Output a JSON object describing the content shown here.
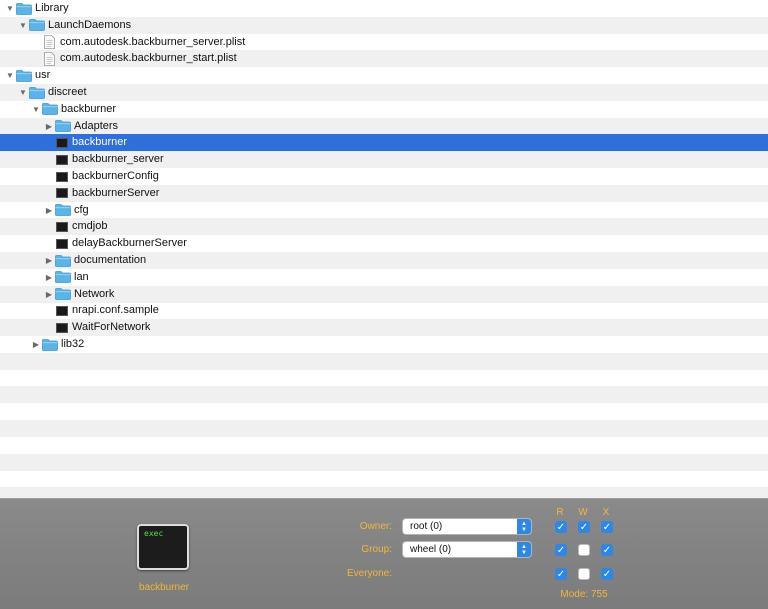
{
  "tree": [
    {
      "label": "Library",
      "kind": "folder",
      "expanded": true,
      "indent": 0,
      "selected": false
    },
    {
      "label": "LaunchDaemons",
      "kind": "folder",
      "expanded": true,
      "indent": 1,
      "selected": false
    },
    {
      "label": "com.autodesk.backburner_server.plist",
      "kind": "doc",
      "indent": 2,
      "selected": false
    },
    {
      "label": "com.autodesk.backburner_start.plist",
      "kind": "doc",
      "indent": 2,
      "selected": false
    },
    {
      "label": "usr",
      "kind": "folder",
      "expanded": true,
      "indent": 0,
      "selected": false
    },
    {
      "label": "discreet",
      "kind": "folder",
      "expanded": true,
      "indent": 1,
      "selected": false
    },
    {
      "label": "backburner",
      "kind": "folder",
      "expanded": true,
      "indent": 2,
      "selected": false
    },
    {
      "label": "Adapters",
      "kind": "folder",
      "expanded": false,
      "indent": 3,
      "selected": false
    },
    {
      "label": "backburner",
      "kind": "exec",
      "indent": 3,
      "selected": true
    },
    {
      "label": "backburner_server",
      "kind": "exec",
      "indent": 3,
      "selected": false
    },
    {
      "label": "backburnerConfig",
      "kind": "exec",
      "indent": 3,
      "selected": false
    },
    {
      "label": "backburnerServer",
      "kind": "exec",
      "indent": 3,
      "selected": false
    },
    {
      "label": "cfg",
      "kind": "folder",
      "expanded": false,
      "indent": 3,
      "selected": false
    },
    {
      "label": "cmdjob",
      "kind": "exec",
      "indent": 3,
      "selected": false
    },
    {
      "label": "delayBackburnerServer",
      "kind": "exec",
      "indent": 3,
      "selected": false
    },
    {
      "label": "documentation",
      "kind": "folder",
      "expanded": false,
      "indent": 3,
      "selected": false
    },
    {
      "label": "lan",
      "kind": "folder",
      "expanded": false,
      "indent": 3,
      "selected": false
    },
    {
      "label": "Network",
      "kind": "folder",
      "expanded": false,
      "indent": 3,
      "selected": false
    },
    {
      "label": "nrapi.conf.sample",
      "kind": "exec",
      "indent": 3,
      "selected": false
    },
    {
      "label": "WaitForNetwork",
      "kind": "exec",
      "indent": 3,
      "selected": false
    },
    {
      "label": "lib32",
      "kind": "folder",
      "expanded": false,
      "indent": 2,
      "selected": false
    }
  ],
  "info": {
    "icon_text": "exec",
    "file_name": "backburner",
    "owner_label": "Owner:",
    "owner_value": "root (0)",
    "group_label": "Group:",
    "group_value": "wheel (0)",
    "everyone_label": "Everyone:",
    "col_r": "R",
    "col_w": "W",
    "col_x": "X",
    "perms": {
      "owner": [
        true,
        true,
        true
      ],
      "group": [
        true,
        false,
        true
      ],
      "everyone": [
        true,
        false,
        true
      ]
    },
    "mode": "Mode: 755"
  },
  "colors": {
    "selection": "#2e6fdc",
    "accent_label": "#f3b53a",
    "checkbox_on": "#2e86e6",
    "folder": "#5ab4e8"
  },
  "icons": {
    "folder": "folder-icon",
    "document": "document-icon",
    "executable": "terminal-exec-icon",
    "disclosure_open": "triangle-down-icon",
    "disclosure_closed": "triangle-right-icon"
  }
}
